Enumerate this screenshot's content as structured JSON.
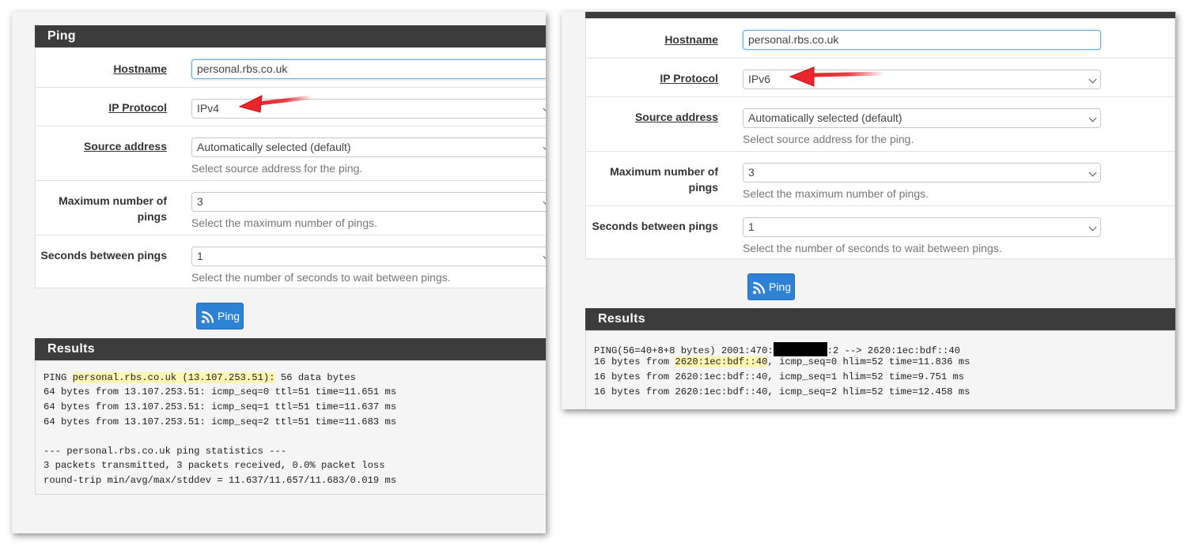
{
  "left": {
    "ping_header": "Ping",
    "form": {
      "hostname": {
        "label": "Hostname",
        "value": "personal.rbs.co.uk"
      },
      "ip_protocol": {
        "label": "IP Protocol",
        "value": "IPv4"
      },
      "source_address": {
        "label": "Source address",
        "value": "Automatically selected (default)",
        "help": "Select source address for the ping."
      },
      "max_pings": {
        "label_line1": "Maximum number of",
        "label_line2": "pings",
        "value": "3",
        "help": "Select the maximum number of pings."
      },
      "seconds_between": {
        "label": "Seconds between pings",
        "value": "1",
        "help": "Select the number of seconds to wait between pings."
      }
    },
    "ping_button": "Ping",
    "results_header": "Results",
    "results": {
      "line1_pre": "PING ",
      "line1_hl": "personal.rbs.co.uk (13.107.253.51):",
      "line1_post": " 56 data bytes",
      "line2": "64 bytes from 13.107.253.51: icmp_seq=0 ttl=51 time=11.651 ms",
      "line3": "64 bytes from 13.107.253.51: icmp_seq=1 ttl=51 time=11.637 ms",
      "line4": "64 bytes from 13.107.253.51: icmp_seq=2 ttl=51 time=11.683 ms",
      "line5": "--- personal.rbs.co.uk ping statistics ---",
      "line6": "3 packets transmitted, 3 packets received, 0.0% packet loss",
      "line7": "round-trip min/avg/max/stddev = 11.637/11.657/11.683/0.019 ms"
    }
  },
  "right": {
    "form": {
      "hostname": {
        "label": "Hostname",
        "value": "personal.rbs.co.uk"
      },
      "ip_protocol": {
        "label": "IP Protocol",
        "value": "IPv6"
      },
      "source_address": {
        "label": "Source address",
        "value": "Automatically selected (default)",
        "help": "Select source address for the ping."
      },
      "max_pings": {
        "label_line1": "Maximum number of",
        "label_line2": "pings",
        "value": "3",
        "help": "Select the maximum number of pings."
      },
      "seconds_between": {
        "label": "Seconds between pings",
        "value": "1",
        "help": "Select the number of seconds to wait between pings."
      }
    },
    "ping_button": "Ping",
    "results_header": "Results",
    "results": {
      "line1_pre": "PING(56=40+8+8 bytes) 2001:470:",
      "line1_post": ":2 --> 2620:1ec:bdf::40",
      "line2_pre": "16 bytes from ",
      "line2_hl": "2620:1ec:bdf::40",
      "line2_post": ", icmp_seq=0 hlim=52 time=11.836 ms",
      "line3": "16 bytes from 2620:1ec:bdf::40, icmp_seq=1 hlim=52 time=9.751 ms",
      "line4": "16 bytes from 2620:1ec:bdf::40, icmp_seq=2 hlim=52 time=12.458 ms"
    }
  },
  "colors": {
    "header": "#3c3c3c",
    "button": "#2d82d6",
    "arrow": "#e8262b",
    "highlight": "#fdf6b2"
  }
}
